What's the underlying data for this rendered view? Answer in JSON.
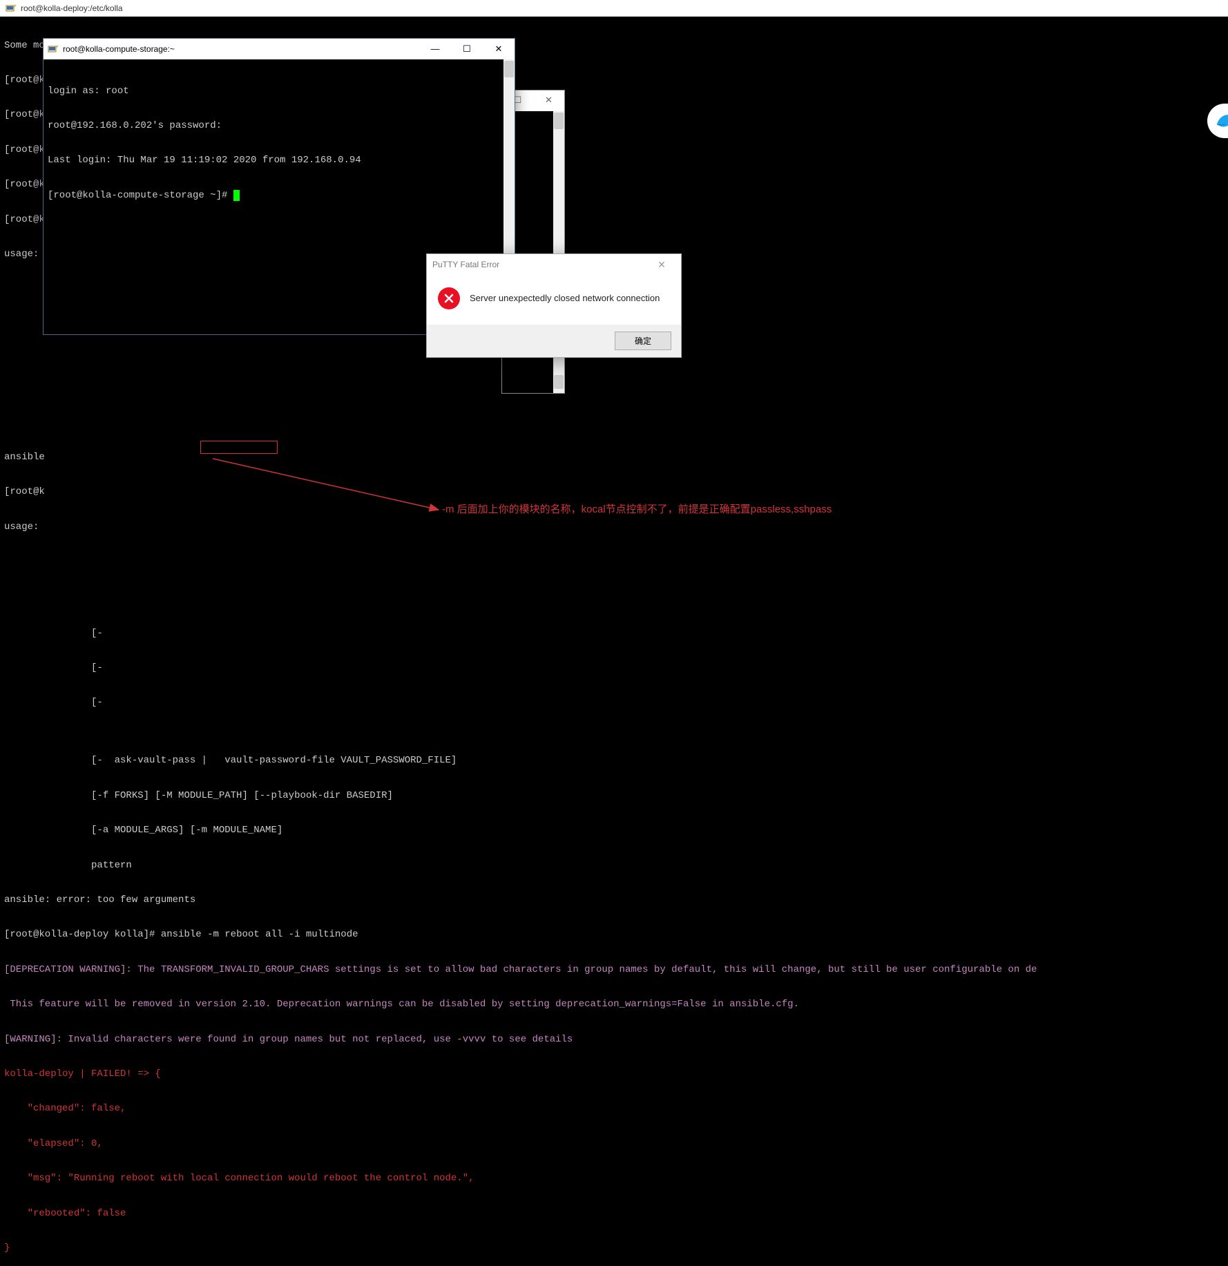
{
  "main_window": {
    "title": "root@kolla-deploy:/etc/kolla"
  },
  "bg_terminal": {
    "lines_top": [
      "Some modules do not make sense in Ad-Hoc (include, meta, etc)",
      "[root@kolla-deploy kolla]#",
      "[root@k",
      "[root@k",
      "[root@k",
      "[root@k",
      "usage: "
    ],
    "lines_mid": [
      "ansible",
      "[root@k",
      "usage: "
    ],
    "lines_bottom": [
      "               [-",
      "               [-",
      "               [-",
      "",
      "               [-  ask-vault-pass |   vault-password-file VAULT_PASSWORD_FILE]",
      "               [-f FORKS] [-M MODULE_PATH] [--playbook-dir BASEDIR]",
      "               [-a MODULE_ARGS] [-m MODULE_NAME]",
      "               pattern",
      "ansible: error: too few arguments"
    ],
    "cmd_line_prompt": "[root@kolla-deploy kolla]# ansible ",
    "cmd_line_boxed": "-m reboot all",
    "cmd_line_tail": " -i multinode",
    "dep_line1": "[DEPRECATION WARNING]: The TRANSFORM_INVALID_GROUP_CHARS settings is set to allow bad characters in group names by default, this will change, but still be user configurable on de",
    "dep_line2": " This feature will be removed in version 2.10. Deprecation warnings can be disabled by setting deprecation_warnings=False in ansible.cfg.",
    "warn_line": "[WARNING]: Invalid characters were found in group names but not replaced, use -vvvv to see details",
    "fail_lines": [
      "kolla-deploy | FAILED! => {",
      "    \"changed\": false,",
      "    \"elapsed\": 0,",
      "    \"msg\": \"Running reboot with local connection would reboot the control node.\",",
      "    \"rebooted\": false",
      "}"
    ]
  },
  "front_window": {
    "title": "root@kolla-compute-storage:~",
    "lines": [
      "login as: root",
      "root@192.168.0.202's password:",
      "Last login: Thu Mar 19 11:19:02 2020 from 192.168.0.94",
      "[root@kolla-compute-storage ~]# "
    ]
  },
  "dialog": {
    "title": "PuTTY Fatal Error",
    "message": "Server unexpectedly closed network connection",
    "ok_label": "确定"
  },
  "annotation": {
    "text": "-m 后面加上你的模块的名称，kocal节点控制不了，前提是正确配置passless,sshpass"
  }
}
